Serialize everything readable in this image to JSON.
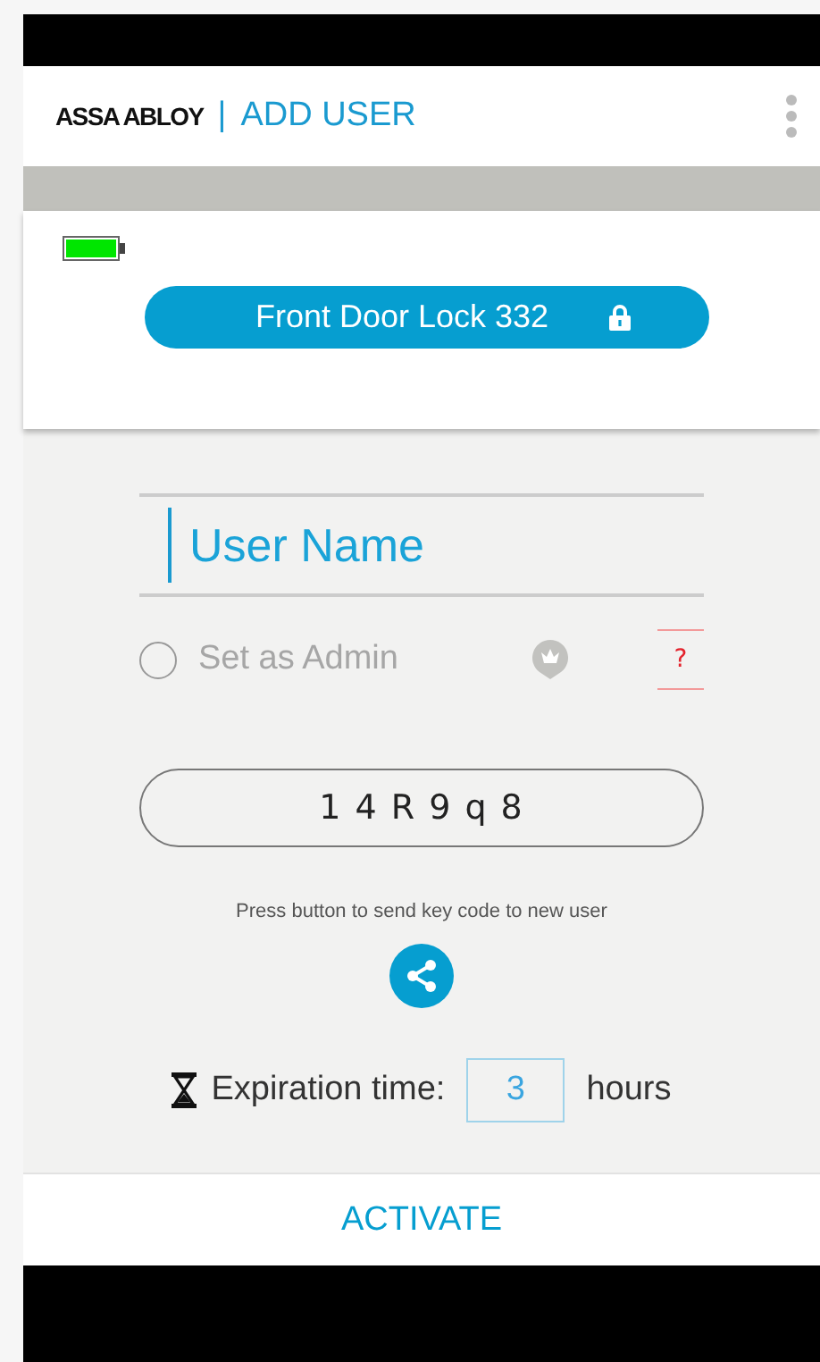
{
  "header": {
    "brand": "ASSA ABLOY",
    "separator": "|",
    "title": "ADD USER"
  },
  "lock": {
    "name": "Front Door Lock 332"
  },
  "user_name": {
    "placeholder": "User Name"
  },
  "admin": {
    "label": "Set as Admin",
    "selected": false,
    "help": "?"
  },
  "key_code": "1 4 R 9 q 8",
  "send_hint": "Press button to send key code to new user",
  "expiration": {
    "label": "Expiration time:",
    "value": "3",
    "unit": "hours"
  },
  "action": "ACTIVATE"
}
